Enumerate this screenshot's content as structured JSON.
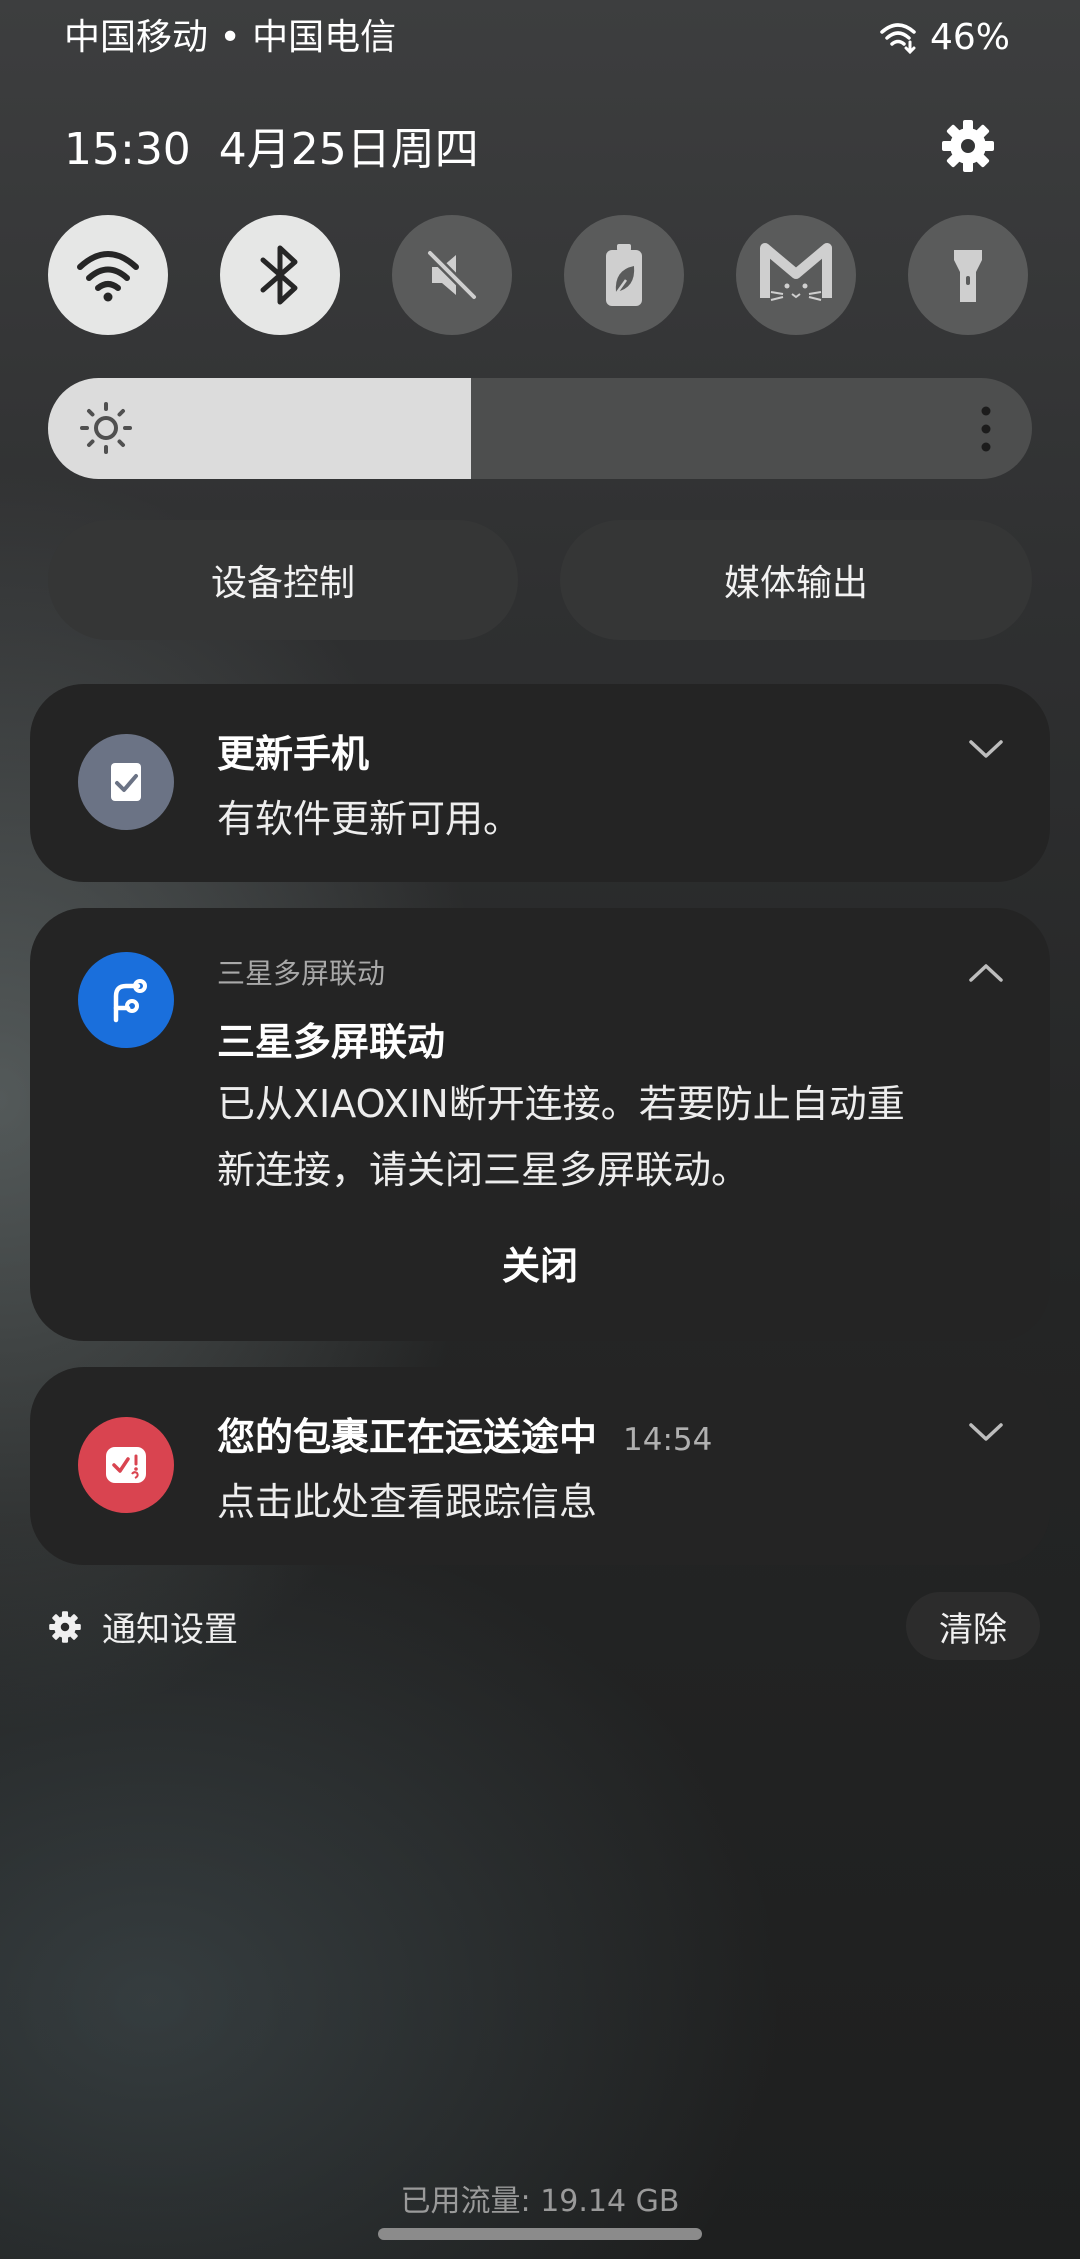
{
  "status_bar": {
    "carriers": "中国移动 • 中国电信",
    "battery": "46%",
    "wifi_icon": "wifi-call-icon"
  },
  "header": {
    "time": "15:30",
    "date": "4月25日周四"
  },
  "quick_settings": [
    {
      "name": "wifi",
      "icon": "wifi-icon",
      "state": "on"
    },
    {
      "name": "bluetooth",
      "icon": "bluetooth-icon",
      "state": "on"
    },
    {
      "name": "sound",
      "icon": "mute-icon",
      "state": "off"
    },
    {
      "name": "power-saving",
      "icon": "battery-leaf-icon",
      "state": "off"
    },
    {
      "name": "cat-app",
      "icon": "cat-m-icon",
      "state": "off"
    },
    {
      "name": "flashlight",
      "icon": "flashlight-icon",
      "state": "off"
    }
  ],
  "brightness": {
    "level": 0.43
  },
  "shortcuts": {
    "device_control": "设备控制",
    "media_output": "媒体输出"
  },
  "notifications": [
    {
      "title": "更新手机",
      "body": "有软件更新可用。",
      "icon": "software-update-icon",
      "icon_color": "#6b7385"
    },
    {
      "app_name": "三星多屏联动",
      "title": "三星多屏联动",
      "body_line1": "已从XIAOXIN断开连接。若要防止自动重",
      "body_line2": "新连接，请关闭三星多屏联动。",
      "action": "关闭",
      "icon": "multi-screen-link-icon",
      "icon_color": "#1a6fdc"
    },
    {
      "title": "您的包裹正在运送途中",
      "time": "14:54",
      "body": "点击此处查看跟踪信息",
      "icon": "package-check-icon",
      "icon_color": "#d94450"
    }
  ],
  "footer": {
    "settings_label": "通知设置",
    "clear_label": "清除",
    "data_usage": "已用流量: 19.14 GB"
  }
}
